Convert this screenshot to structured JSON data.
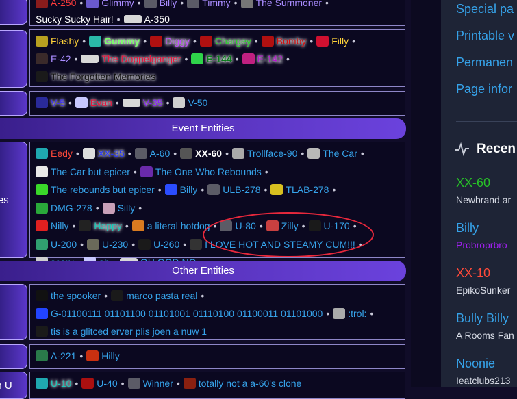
{
  "sections": {
    "event_header": "Event Entities",
    "other_header": "Other Entities",
    "event_left": "ities",
    "bottom_left": "on U"
  },
  "row_top": [
    {
      "label": "A-250",
      "color": "#ff3b3b",
      "icon": "red-creature-icon"
    },
    {
      "label": "Glimmy",
      "color": "#a98cff",
      "icon": "sparkle-icon"
    },
    {
      "label": "Billy",
      "color": "#a98cff",
      "icon": "ghost-icon"
    },
    {
      "label": "Timmy",
      "color": "#a98cff",
      "icon": "ghost-icon"
    },
    {
      "label": "The Summoner",
      "color": "#a98cff",
      "icon": "summoner-icon"
    },
    {
      "label": "Sucky Sucky Hair!",
      "color": "#ffffff",
      "icon": "none",
      "newline": true
    },
    {
      "label": "A-350",
      "color": "#ffffff",
      "icon": "card-icon"
    }
  ],
  "row_b": [
    {
      "label": "Flashy",
      "color": "#ffd23a",
      "icon": "flashy-icon"
    },
    {
      "label": "Gummy",
      "color": "#7cff6b",
      "icon": "gummy-icon",
      "bold": true,
      "glow": true
    },
    {
      "label": "Diggy",
      "color": "#c04cff",
      "icon": "flag-icon",
      "glow": true
    },
    {
      "label": "Chargey",
      "color": "#2bd12b",
      "icon": "flag-icon",
      "glow": true
    },
    {
      "label": "Bomby",
      "color": "#d01010",
      "icon": "flag-icon",
      "glow": true
    },
    {
      "label": "Filly",
      "color": "#ffd23a",
      "icon": "bag-icon"
    },
    {
      "label": "E-42",
      "color": "#a98cff",
      "icon": "mask-icon"
    },
    {
      "label": "The Doppelganger",
      "color": "#e8143c",
      "icon": "card-icon",
      "glow": true
    },
    {
      "label": "E-144",
      "color": "#0a7a1c",
      "icon": "green-face-icon",
      "bold": true,
      "glow": true
    },
    {
      "label": "E-142",
      "color": "#b01cc8",
      "icon": "pink-x-icon",
      "glow": true
    },
    {
      "label": "The Forgotten Memories",
      "color": "#101010",
      "icon": "dark-icon",
      "glow": true
    }
  ],
  "row_c": [
    {
      "label": "V-5",
      "color": "#3a2bff",
      "icon": "blue-icon",
      "glow": true
    },
    {
      "label": "Evan",
      "color": "#e8143c",
      "icon": "percent-icon",
      "glow": true
    },
    {
      "label": "V-35",
      "color": "#8a1cff",
      "icon": "card-icon",
      "glow": true
    },
    {
      "label": "V-50",
      "color": "#36a3ea",
      "icon": "smile-icon"
    }
  ],
  "row_event": [
    {
      "label": "Eedy",
      "color": "#ff4a3a",
      "icon": "cyan-face-icon"
    },
    {
      "label": "XX-35",
      "color": "#2233ff",
      "icon": "ball-icon",
      "glow": true
    },
    {
      "label": "A-60",
      "color": "#36a3ea",
      "icon": "ghost-icon"
    },
    {
      "label": "XX-60",
      "color": "#ffffff",
      "icon": "scissor-icon",
      "bold": true
    },
    {
      "label": "Trollface-90",
      "color": "#36a3ea",
      "icon": "trollface-icon"
    },
    {
      "label": "The Car",
      "color": "#36a3ea",
      "icon": "car-icon"
    },
    {
      "label": "The Car but epicer",
      "color": "#36a3ea",
      "icon": "face-icon"
    },
    {
      "label": "The One Who Rebounds",
      "color": "#36a3ea",
      "icon": "purple-swirl-icon"
    },
    {
      "label": "The rebounds but epicer",
      "color": "#36a3ea",
      "icon": "green-smile-icon"
    },
    {
      "label": "Billy",
      "color": "#36a3ea",
      "icon": "blue-smile-icon"
    },
    {
      "label": "ULB-278",
      "color": "#36a3ea",
      "icon": "ghost-icon"
    },
    {
      "label": "TLAB-278",
      "color": "#36a3ea",
      "icon": "yellow-blob-icon"
    },
    {
      "label": "DMG-278",
      "color": "#36a3ea",
      "icon": "green-frog-icon"
    },
    {
      "label": "Silly",
      "color": "#36a3ea",
      "icon": "lips-icon"
    },
    {
      "label": "Nilly",
      "color": "#36a3ea",
      "icon": "red-heart-icon",
      "newline": true
    },
    {
      "label": "Happy",
      "color": "#1ac8b8",
      "icon": "dark-face-icon",
      "glow": true
    },
    {
      "label": "a literal hotdog",
      "color": "#36a3ea",
      "icon": "hotdog-icon"
    },
    {
      "label": "U-80",
      "color": "#36a3ea",
      "icon": "ghost-icon"
    },
    {
      "label": "Zilly",
      "color": "#36a3ea",
      "icon": "mouth-icon"
    },
    {
      "label": "U-170",
      "color": "#36a3ea",
      "icon": "dark-icon"
    },
    {
      "label": "U-200",
      "color": "#36a3ea",
      "icon": "green-skull-icon"
    },
    {
      "label": "U-230",
      "color": "#36a3ea",
      "icon": "portrait-icon"
    },
    {
      "label": "U-260",
      "color": "#36a3ea",
      "icon": "dark-icon"
    },
    {
      "label": "I LOVE HOT AND STEAMY CUM!!!",
      "color": "#36a3ea",
      "icon": "glitch-icon"
    },
    {
      "label": "scary",
      "color": "#36a3ea",
      "icon": "eyes-icon"
    },
    {
      "label": "ah",
      "color": "#36a3ea",
      "icon": "ah-icon"
    },
    {
      "label": "OH GOD NO",
      "color": "#36a3ea",
      "icon": "card-icon"
    }
  ],
  "row_other": [
    {
      "label": "the spooker",
      "color": "#36a3ea",
      "icon": "spooker-icon"
    },
    {
      "label": "marco pasta real",
      "color": "#36a3ea",
      "icon": "dark-icon"
    },
    {
      "label": "G-01100111 01101100 01101001 01110100 01100011 01101000",
      "color": "#36a3ea",
      "icon": "eye-icon"
    },
    {
      "label": ":trol:",
      "color": "#36a3ea",
      "icon": "trollface-icon"
    },
    {
      "label": "tis is a glitced erver plis joen a nuw 1",
      "color": "#36a3ea",
      "icon": "dark-icon"
    }
  ],
  "row_f": [
    {
      "label": "A-221",
      "color": "#36a3ea",
      "icon": "green-box-icon"
    },
    {
      "label": "Hilly",
      "color": "#36a3ea",
      "icon": "red-smile-icon"
    }
  ],
  "row_g": [
    {
      "label": "U-10",
      "color": "#1ac8b8",
      "icon": "cyan-face-icon",
      "glow": true
    },
    {
      "label": "U-40",
      "color": "#36a3ea",
      "icon": "red-eyes-icon"
    },
    {
      "label": "Winner",
      "color": "#36a3ea",
      "icon": "ghost-icon"
    },
    {
      "label": "totally not a a-60's clone",
      "color": "#36a3ea",
      "icon": "red-swirl-icon"
    }
  ],
  "sidebar": {
    "links": [
      "Special pa",
      "Printable v",
      "Permanen",
      "Page infor"
    ],
    "recent_title": "Recen",
    "recent": [
      {
        "title": "XX-60",
        "title_color": "#27c227",
        "user": "Newbrand ar",
        "user_color": "#d8dce6"
      },
      {
        "title": "Billy",
        "title_color": "#36a3ea",
        "user": "Probroprbro",
        "user_color": "#a020f0"
      },
      {
        "title": "XX-10",
        "title_color": "#ff4a3a",
        "user": "EpikoSunker",
        "user_color": "#d8dce6"
      },
      {
        "title": "Bully Billy",
        "title_color": "#36a3ea",
        "user": "A Rooms Fan",
        "user_color": "#d8dce6"
      },
      {
        "title": "Noonie",
        "title_color": "#36a3ea",
        "user": "Ieatclubs213",
        "user_color": "#d8dce6"
      }
    ]
  },
  "colors": {
    "accent": "#36a3ea",
    "highlight_circle": "#e8283c"
  }
}
